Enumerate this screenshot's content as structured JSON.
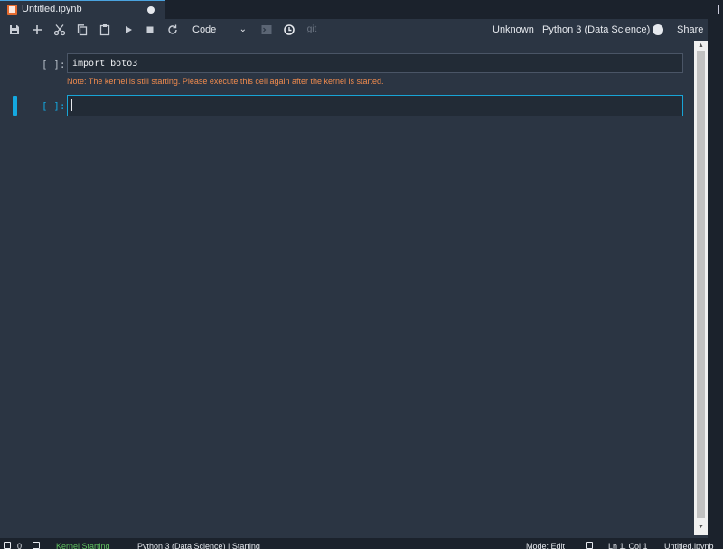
{
  "tab": {
    "title": "Untitled.ipynb"
  },
  "toolbar": {
    "cell_type": "Code",
    "kernel_status": "Unknown",
    "kernel_name": "Python 3 (Data Science)",
    "share_label": "Share",
    "git_label": "git"
  },
  "cells": [
    {
      "prompt": "[ ]:",
      "source": "import boto3",
      "note": "Note: The kernel is still starting. Please execute this cell again after the kernel is started."
    },
    {
      "prompt": "[ ]:",
      "source": ""
    }
  ],
  "statusbar": {
    "count": "0",
    "kernel_state": "Kernel Starting",
    "kernel_info": "Python 3 (Data Science) | Starting",
    "mode": "Mode: Edit",
    "position": "Ln 1, Col 1",
    "file": "Untitled.ipynb"
  },
  "colors": {
    "accent": "#14a8e0",
    "warning": "#f08b4e",
    "tab_icon": "#e56b2f"
  }
}
